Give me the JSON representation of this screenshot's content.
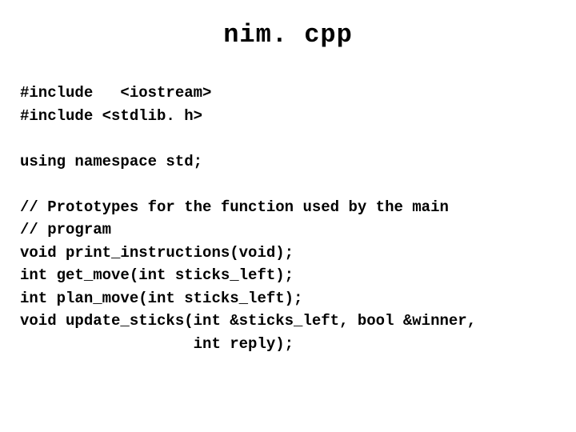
{
  "title": "nim. cpp",
  "code": {
    "line1": "#include   <iostream>",
    "line2": "#include <stdlib. h>",
    "line3": "",
    "line4": "using namespace std;",
    "line5": "",
    "line6": "// Prototypes for the function used by the main",
    "line7": "// program",
    "line8": "void print_instructions(void);",
    "line9": "int get_move(int sticks_left);",
    "line10": "int plan_move(int sticks_left);",
    "line11": "void update_sticks(int &sticks_left, bool &winner,",
    "line12": "                   int reply);"
  }
}
